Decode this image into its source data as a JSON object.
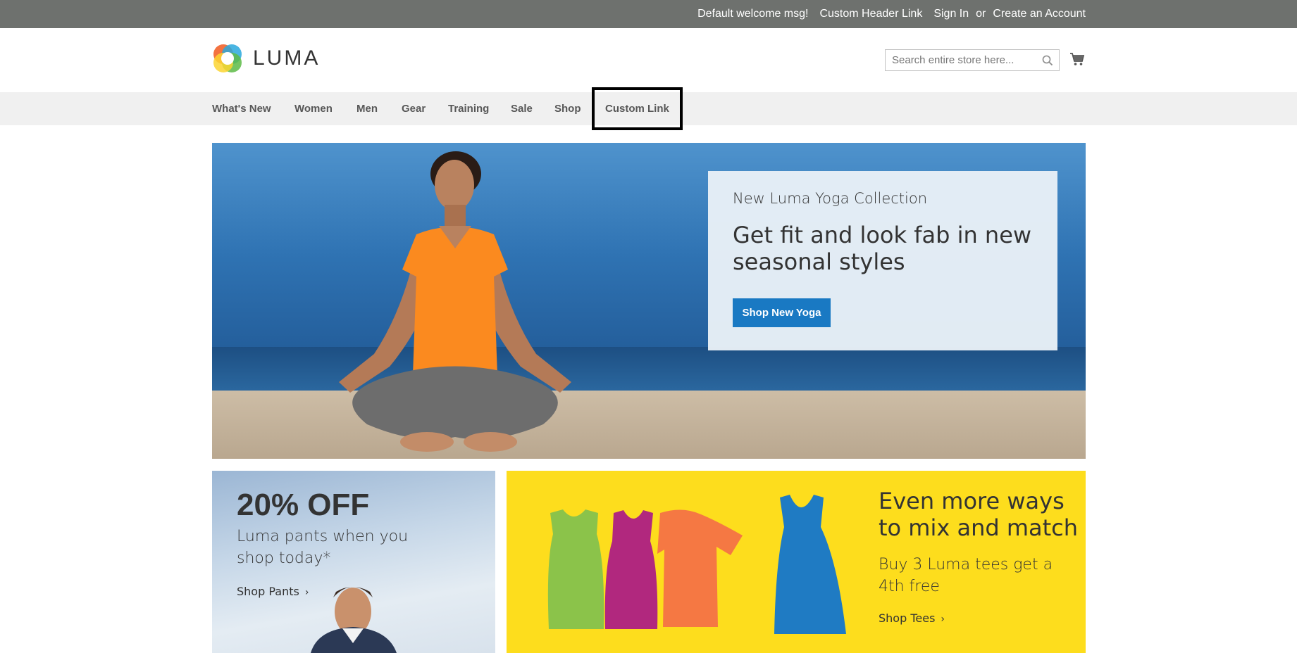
{
  "header_links": {
    "welcome": "Default welcome msg!",
    "custom_header_link": "Custom Header Link",
    "sign_in": "Sign In",
    "or": "or",
    "create_account": "Create an Account"
  },
  "logo": {
    "text": "LUMA"
  },
  "search": {
    "placeholder": "Search entire store here...",
    "value": ""
  },
  "nav": {
    "items": [
      {
        "label": "What's New"
      },
      {
        "label": "Women"
      },
      {
        "label": "Men"
      },
      {
        "label": "Gear"
      },
      {
        "label": "Training"
      },
      {
        "label": "Sale"
      },
      {
        "label": "Shop"
      },
      {
        "label": "Custom Link"
      }
    ]
  },
  "hero": {
    "kicker": "New Luma Yoga Collection",
    "headline": "Get fit and look fab in new seasonal styles",
    "button": "Shop New Yoga"
  },
  "pants_promo": {
    "discount": "20% OFF",
    "description": "Luma pants when you shop today*",
    "link": "Shop Pants"
  },
  "tees_promo": {
    "heading": "Even more ways to mix and match",
    "description": "Buy 3 Luma tees get a 4th free",
    "link": "Shop Tees"
  },
  "colors": {
    "top_bar": "#6e716e",
    "nav_bg": "#f0f0f0",
    "primary_button": "#1979c3",
    "tees_bg": "#fddd1d"
  }
}
